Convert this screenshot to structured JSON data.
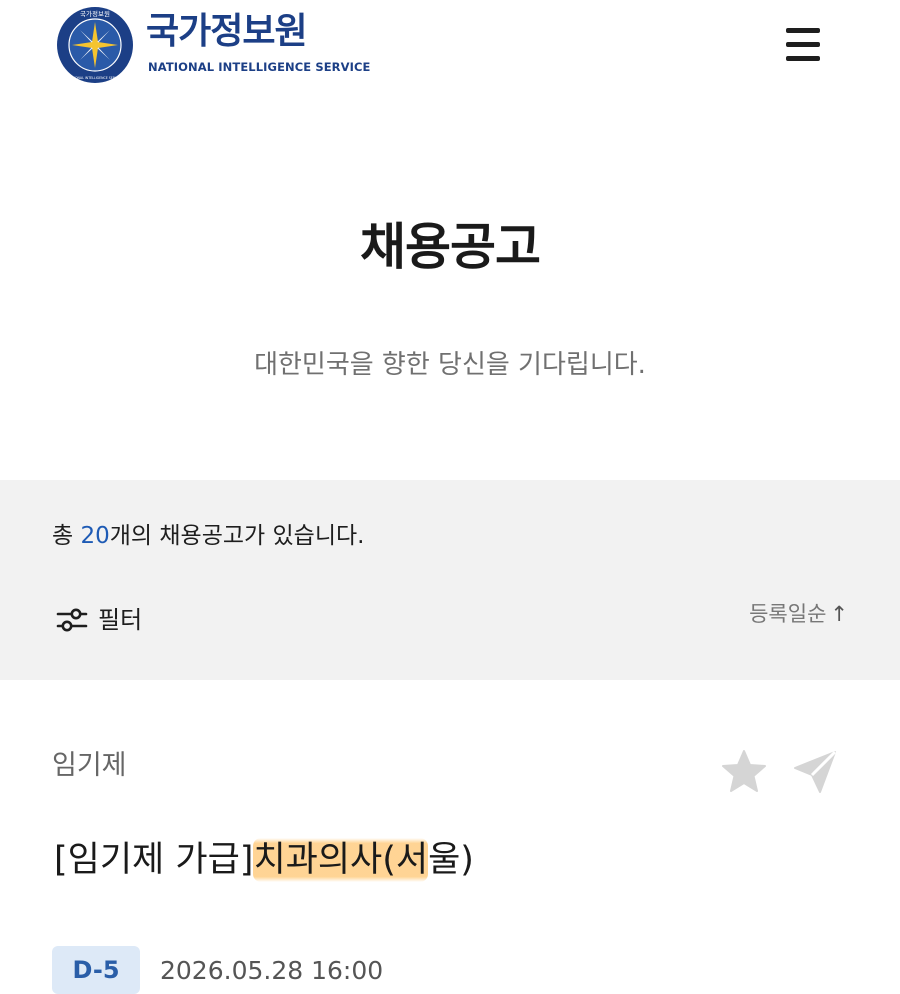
{
  "header": {
    "brand_ko": "국가정보원",
    "brand_en": "NATIONAL INTELLIGENCE SERVICE",
    "emblem_text": "국가정보원",
    "emblem_sub": "NATIONAL INTELLIGENCE SERVICE",
    "menu_icon": "hamburger-menu-icon"
  },
  "hero": {
    "title": "채용공고",
    "subtitle": "대한민국을 향한 당신을 기다립니다."
  },
  "summary": {
    "prefix": "총 ",
    "count": "20",
    "suffix": "개의 채용공고가 있습니다.",
    "filter_label": "필터",
    "filter_icon": "sliders-icon",
    "sort_label": "등록일순",
    "sort_arrow": "↑"
  },
  "job": {
    "category": "임기제",
    "title_prefix": "[임기제 가급]",
    "title_highlight": "치과의사(서",
    "title_suffix": "울)",
    "dday": "D-5",
    "deadline": "2026.05.28 16:00",
    "favorite_icon": "star-icon",
    "share_icon": "share-icon"
  },
  "colors": {
    "brand": "#1c3f86",
    "accent": "#1e5bb5",
    "band_bg": "#f2f2f2",
    "highlight": "#ffcd82",
    "dday_bg": "#dde9f7"
  }
}
